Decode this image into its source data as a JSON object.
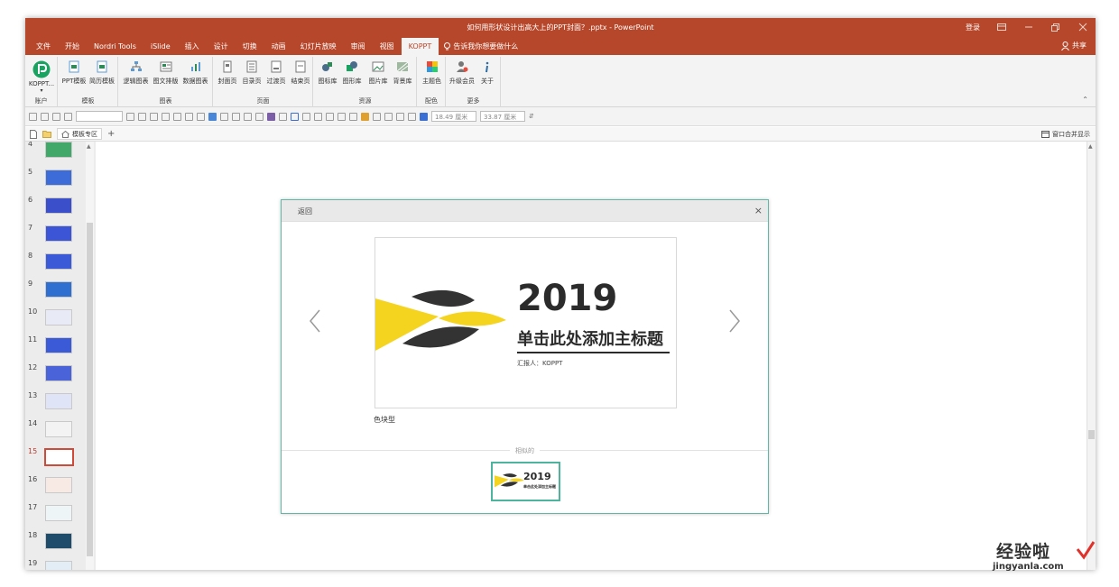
{
  "window": {
    "title": "如何用形状设计出高大上的PPT封面？.pptx - PowerPoint",
    "login": "登录"
  },
  "tabs": [
    "文件",
    "开始",
    "Nordri Tools",
    "iSlide",
    "插入",
    "设计",
    "切换",
    "动画",
    "幻灯片放映",
    "审阅",
    "视图",
    "KOPPT"
  ],
  "active_tab": "KOPPT",
  "tell_me": "告诉我你想要做什么",
  "share": "共享",
  "ribbon": {
    "groups": [
      {
        "label": "账户",
        "buttons": [
          "KOPPT..."
        ]
      },
      {
        "label": "模板",
        "buttons": [
          "PPT模板",
          "简历模板"
        ]
      },
      {
        "label": "图表",
        "buttons": [
          "逻辑图表",
          "图文排版",
          "数据图表"
        ]
      },
      {
        "label": "页面",
        "buttons": [
          "封面页",
          "目录页",
          "过渡页",
          "结束页"
        ]
      },
      {
        "label": "资源",
        "buttons": [
          "图标库",
          "图形库",
          "图片库",
          "背景库"
        ]
      },
      {
        "label": "配色",
        "buttons": [
          "主题色"
        ]
      },
      {
        "label": "更多",
        "buttons": [
          "升级会员",
          "关于"
        ]
      }
    ]
  },
  "format_bar": {
    "width": "18.49 厘米",
    "height": "33.87 厘米"
  },
  "doc_tab": {
    "label": "模板专区",
    "window_merge": "窗口合并显示"
  },
  "slides": [
    {
      "num": "4",
      "selected": false,
      "color": "#41a86a"
    },
    {
      "num": "5",
      "selected": false,
      "color": "#3d6bd8"
    },
    {
      "num": "6",
      "selected": false,
      "color": "#3a4fc9"
    },
    {
      "num": "7",
      "selected": false,
      "color": "#3b55d6"
    },
    {
      "num": "8",
      "selected": false,
      "color": "#3b5ad8"
    },
    {
      "num": "9",
      "selected": false,
      "color": "#2f6fd0"
    },
    {
      "num": "10",
      "selected": false,
      "color": "#e8eaf5"
    },
    {
      "num": "11",
      "selected": false,
      "color": "#3b5ad8"
    },
    {
      "num": "12",
      "selected": false,
      "color": "#4b63d9"
    },
    {
      "num": "13",
      "selected": false,
      "color": "#dfe5f7"
    },
    {
      "num": "14",
      "selected": false,
      "color": "#f3f3f3"
    },
    {
      "num": "15",
      "selected": true,
      "color": "#ffffff"
    },
    {
      "num": "16",
      "selected": false,
      "color": "#f7e9e4"
    },
    {
      "num": "17",
      "selected": false,
      "color": "#eef5f7"
    },
    {
      "num": "18",
      "selected": false,
      "color": "#1f4c6b"
    },
    {
      "num": "19",
      "selected": false,
      "color": "#e3edf6"
    }
  ],
  "dialog": {
    "back": "返回",
    "close": "×",
    "preview": {
      "year": "2019",
      "title": "单击此处添加主标题",
      "reporter": "汇报人：KOPPT"
    },
    "template_name": "色块型",
    "similar_label": "相似的",
    "mini": {
      "year": "2019",
      "title": "单击此处添加主标题"
    }
  },
  "watermark": {
    "cn": "经验啦",
    "en": "jingyanla.com"
  },
  "colors": {
    "ppt_red": "#b7472a",
    "dialog_teal": "#4fb49e",
    "logo_yellow": "#f5d41f",
    "logo_dark": "#333333"
  }
}
